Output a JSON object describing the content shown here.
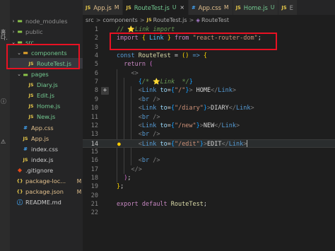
{
  "sidebar": {
    "side_glyphs": [
      "홈다.",
      "ⓘ",
      "⚠"
    ],
    "items": [
      {
        "label": "node_modules",
        "badge": "",
        "kind": "folder",
        "depth": 0
      },
      {
        "label": "public",
        "badge": "",
        "kind": "folder",
        "depth": 0
      },
      {
        "label": "src",
        "badge": "",
        "kind": "folder-open",
        "depth": 0
      },
      {
        "label": "components",
        "badge": "•",
        "kind": "folder-open-orange",
        "depth": 1
      },
      {
        "label": "RouteTest.js",
        "badge": "U",
        "kind": "js",
        "depth": 2
      },
      {
        "label": "pages",
        "badge": "",
        "kind": "folder-open",
        "depth": 1
      },
      {
        "label": "Diary.js",
        "badge": "U",
        "kind": "js",
        "depth": 2
      },
      {
        "label": "Edit.js",
        "badge": "U",
        "kind": "js",
        "depth": 2
      },
      {
        "label": "Home.js",
        "badge": "U",
        "kind": "js",
        "depth": 2
      },
      {
        "label": "New.js",
        "badge": "U",
        "kind": "js",
        "depth": 2
      },
      {
        "label": "App.css",
        "badge": "M",
        "kind": "css",
        "depth": 1
      },
      {
        "label": "App.js",
        "badge": "M",
        "kind": "js",
        "depth": 1
      },
      {
        "label": "index.css",
        "badge": "",
        "kind": "css",
        "depth": 1
      },
      {
        "label": "index.js",
        "badge": "",
        "kind": "js",
        "depth": 1
      },
      {
        "label": ".gitignore",
        "badge": "",
        "kind": "git",
        "depth": 0
      },
      {
        "label": "package-loc...",
        "badge": "M",
        "kind": "json",
        "depth": 0
      },
      {
        "label": "package.json",
        "badge": "M",
        "kind": "json",
        "depth": 0
      },
      {
        "label": "README.md",
        "badge": "",
        "kind": "md",
        "depth": 0
      }
    ]
  },
  "tabs": [
    {
      "icon": "JS",
      "name": "App.js",
      "status": "M",
      "active": false,
      "close": ""
    },
    {
      "icon": "JS",
      "name": "RouteTest.js",
      "status": "U",
      "active": true,
      "close": "×"
    },
    {
      "icon": "#",
      "name": "App.css",
      "status": "M",
      "active": false,
      "close": ""
    },
    {
      "icon": "JS",
      "name": "Home.js",
      "status": "U",
      "active": false,
      "close": ""
    },
    {
      "icon": "JS",
      "name": "E",
      "status": "",
      "active": false,
      "close": ""
    }
  ],
  "breadcrumb": {
    "parts": [
      "src",
      "components"
    ],
    "file": "RouteTest.js",
    "symbol": "RouteTest",
    "sep": ">"
  },
  "editor": {
    "current_line": 14,
    "plus_line": 8,
    "lines": [
      {
        "n": "1",
        "tokens": [
          [
            "cmt",
            "// "
          ],
          [
            "star",
            "⭐"
          ],
          [
            "cmt",
            "Link import"
          ]
        ]
      },
      {
        "n": "2",
        "tokens": [
          [
            "kwc",
            "import"
          ],
          [
            "txt",
            " "
          ],
          [
            "b1",
            "{"
          ],
          [
            "txt",
            " "
          ],
          [
            "var",
            "Link"
          ],
          [
            "txt",
            " "
          ],
          [
            "b1",
            "}"
          ],
          [
            "txt",
            " "
          ],
          [
            "kwc",
            "from"
          ],
          [
            "txt",
            " "
          ],
          [
            "str",
            "\"react-router-dom\""
          ],
          [
            "txt",
            ";"
          ]
        ]
      },
      {
        "n": "3",
        "tokens": []
      },
      {
        "n": "4",
        "tokens": [
          [
            "kw",
            "const"
          ],
          [
            "txt",
            " "
          ],
          [
            "fn",
            "RouteTest"
          ],
          [
            "txt",
            " = "
          ],
          [
            "b1",
            "("
          ],
          [
            "b1",
            ")"
          ],
          [
            "txt",
            " "
          ],
          [
            "kw",
            "=>"
          ],
          [
            "txt",
            " "
          ],
          [
            "b1",
            "{"
          ]
        ]
      },
      {
        "n": "5",
        "tokens": [
          [
            "txt",
            "  "
          ],
          [
            "kwc",
            "return"
          ],
          [
            "txt",
            " "
          ],
          [
            "b2",
            "("
          ]
        ]
      },
      {
        "n": "6",
        "tokens": [
          [
            "txt",
            "    "
          ],
          [
            "punc",
            "<>"
          ]
        ]
      },
      {
        "n": "7",
        "tokens": [
          [
            "txt",
            "      "
          ],
          [
            "b3",
            "{"
          ],
          [
            "cmt",
            "/* "
          ],
          [
            "star",
            "⭐"
          ],
          [
            "cmt",
            "Link  */"
          ],
          [
            "b3",
            "}"
          ]
        ]
      },
      {
        "n": "8",
        "tokens": [
          [
            "txt",
            "      "
          ],
          [
            "punc",
            "<"
          ],
          [
            "tag",
            "Link"
          ],
          [
            "txt",
            " "
          ],
          [
            "attr",
            "to"
          ],
          [
            "txt",
            "="
          ],
          [
            "b3",
            "{"
          ],
          [
            "str",
            "\"/\""
          ],
          [
            "b3",
            "}"
          ],
          [
            "punc",
            ">"
          ],
          [
            "txt",
            " HOME"
          ],
          [
            "punc",
            "</"
          ],
          [
            "tag",
            "Link"
          ],
          [
            "punc",
            ">"
          ]
        ]
      },
      {
        "n": "9",
        "tokens": [
          [
            "txt",
            "      "
          ],
          [
            "punc",
            "<"
          ],
          [
            "tag",
            "br"
          ],
          [
            "txt",
            " "
          ],
          [
            "punc",
            "/>"
          ]
        ]
      },
      {
        "n": "10",
        "tokens": [
          [
            "txt",
            "      "
          ],
          [
            "punc",
            "<"
          ],
          [
            "tag",
            "Link"
          ],
          [
            "txt",
            " "
          ],
          [
            "attr",
            "to"
          ],
          [
            "txt",
            "="
          ],
          [
            "b3",
            "{"
          ],
          [
            "str",
            "\"/diary\""
          ],
          [
            "b3",
            "}"
          ],
          [
            "punc",
            ">"
          ],
          [
            "txt",
            "DIARY"
          ],
          [
            "punc",
            "</"
          ],
          [
            "tag",
            "Link"
          ],
          [
            "punc",
            ">"
          ]
        ]
      },
      {
        "n": "11",
        "tokens": [
          [
            "txt",
            "      "
          ],
          [
            "punc",
            "<"
          ],
          [
            "tag",
            "br"
          ],
          [
            "txt",
            " "
          ],
          [
            "punc",
            "/>"
          ]
        ]
      },
      {
        "n": "12",
        "tokens": [
          [
            "txt",
            "      "
          ],
          [
            "punc",
            "<"
          ],
          [
            "tag",
            "Link"
          ],
          [
            "txt",
            " "
          ],
          [
            "attr",
            "to"
          ],
          [
            "txt",
            "="
          ],
          [
            "b3",
            "{"
          ],
          [
            "str",
            "\"/new\""
          ],
          [
            "b3",
            "}"
          ],
          [
            "punc",
            ">"
          ],
          [
            "txt",
            "NEW"
          ],
          [
            "punc",
            "</"
          ],
          [
            "tag",
            "Link"
          ],
          [
            "punc",
            ">"
          ]
        ]
      },
      {
        "n": "13",
        "tokens": [
          [
            "txt",
            "      "
          ],
          [
            "punc",
            "<"
          ],
          [
            "tag",
            "br"
          ],
          [
            "txt",
            " "
          ],
          [
            "punc",
            "/>"
          ]
        ]
      },
      {
        "n": "14",
        "tokens": [
          [
            "txt",
            "      "
          ],
          [
            "punc",
            "<"
          ],
          [
            "tag",
            "Link"
          ],
          [
            "txt",
            " "
          ],
          [
            "attr",
            "to"
          ],
          [
            "txt",
            "="
          ],
          [
            "b3",
            "{"
          ],
          [
            "str",
            "\"/edit\""
          ],
          [
            "b3",
            "}"
          ],
          [
            "punc",
            ">"
          ],
          [
            "txt",
            "EDIT"
          ],
          [
            "punc",
            "</"
          ],
          [
            "tag",
            "Link"
          ],
          [
            "punc",
            ">"
          ]
        ]
      },
      {
        "n": "15",
        "tokens": []
      },
      {
        "n": "16",
        "tokens": [
          [
            "txt",
            "      "
          ],
          [
            "punc",
            "<"
          ],
          [
            "tag",
            "br"
          ],
          [
            "txt",
            " "
          ],
          [
            "punc",
            "/>"
          ]
        ]
      },
      {
        "n": "17",
        "tokens": [
          [
            "txt",
            "    "
          ],
          [
            "punc",
            "</>"
          ]
        ]
      },
      {
        "n": "18",
        "tokens": [
          [
            "txt",
            "  "
          ],
          [
            "b2",
            ")"
          ],
          [
            "txt",
            ";"
          ]
        ]
      },
      {
        "n": "19",
        "tokens": [
          [
            "b1",
            "}"
          ],
          [
            "txt",
            ";"
          ]
        ]
      },
      {
        "n": "20",
        "tokens": []
      },
      {
        "n": "21",
        "tokens": [
          [
            "kwc",
            "export"
          ],
          [
            "txt",
            " "
          ],
          [
            "kwc",
            "default"
          ],
          [
            "txt",
            " "
          ],
          [
            "fn",
            "RouteTest"
          ],
          [
            "txt",
            ";"
          ]
        ]
      },
      {
        "n": "22",
        "tokens": []
      }
    ]
  },
  "colors": {
    "highlight_box": "#e81123",
    "editor_bg": "#1e1e1e",
    "sidebar_bg": "#252526",
    "modified": "#e2c08d",
    "untracked": "#73c991"
  }
}
